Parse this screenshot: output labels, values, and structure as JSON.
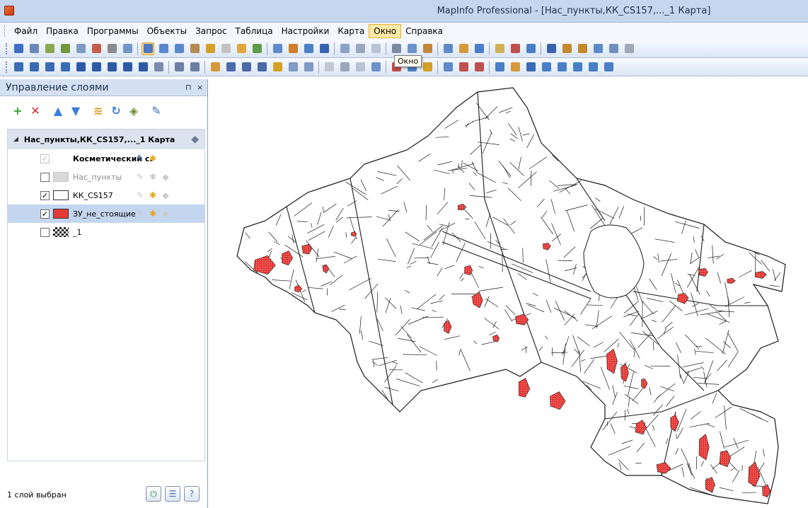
{
  "window": {
    "title": "MapInfo Professional - [Нас_пункты,КК_CS157,..._1 Карта]"
  },
  "menu": [
    {
      "label": "Файл",
      "active": false
    },
    {
      "label": "Правка",
      "active": false
    },
    {
      "label": "Программы",
      "active": false
    },
    {
      "label": "Объекты",
      "active": false
    },
    {
      "label": "Запрос",
      "active": false
    },
    {
      "label": "Таблица",
      "active": false
    },
    {
      "label": "Настройки",
      "active": false
    },
    {
      "label": "Карта",
      "active": false
    },
    {
      "label": "Окно",
      "active": true
    },
    {
      "label": "Справка",
      "active": false
    }
  ],
  "tooltip": {
    "text": "Окно"
  },
  "toolbar1": [
    "#3d6ec8",
    "#6a88b8",
    "#8aa94a",
    "#6f9a3a",
    "#7f9ac3",
    "#c45d4a",
    "#8b8b8b",
    "#7296c8",
    "#4c78c5",
    "#5a86cf",
    "#5a86cf",
    "#b48b52",
    "#d4a027",
    "#c2c2c2",
    "#e0a63a",
    "#5e9a4a",
    "#5d8ac9",
    "#d07d2c",
    "#4a7ec5",
    "#3a62b0",
    "#8aa2c8",
    "#9aa8bd",
    "#b8c3d3",
    "#7b8aa0",
    "#6d91c9",
    "#c2873a",
    "#5d8ac9",
    "#d6993a",
    "#4a7ec5",
    "#d1b05a",
    "#c05050",
    "#4a7ec5",
    "#3a62b0",
    "#c28a2c",
    "#c28a2c",
    "#5d8ac9",
    "#6e8fbf",
    "#a0a9b8"
  ],
  "toolbar2": [
    "#3b6bb3",
    "#3b6bb3",
    "#3b6bb3",
    "#3b6bb3",
    "#2d5aa5",
    "#2d5aa5",
    "#2d5aa5",
    "#2d5aa5",
    "#2d5aa5",
    "#7b8bb0",
    "#6d7fa6",
    "#6d7fa6",
    "#d6993a",
    "#4a6aa8",
    "#4a6aa8",
    "#4a6aa8",
    "#d4a027",
    "#7f9ac3",
    "#7f9ac3",
    "#c0c7d2",
    "#9aa8bd",
    "#b8c3d3",
    "#6d91c9",
    "#c24a4a",
    "#4a7ec5",
    "#d4a027",
    "#5d8ac9",
    "#c05050",
    "#c05050",
    "#4a7ec5",
    "#d6993a",
    "#3b6bb3",
    "#4a7ec5",
    "#4a7ec5",
    "#4a7ec5",
    "#4a7ec5",
    "#4a7ec5"
  ],
  "layer_panel": {
    "title": "Управление слоями",
    "pin": "⊓",
    "close": "×",
    "tools": [
      {
        "icon": "add-layer-icon",
        "glyph": "+",
        "color": "#3aa53a"
      },
      {
        "icon": "remove-layer-icon",
        "glyph": "✕",
        "color": "#d03030"
      },
      {
        "icon": "move-up-icon",
        "glyph": "▲",
        "color": "#3b7dd8"
      },
      {
        "icon": "move-down-icon",
        "glyph": "▼",
        "color": "#3b7dd8"
      },
      {
        "icon": "layer-properties-icon",
        "glyph": "≋",
        "color": "#d4a027"
      },
      {
        "icon": "refresh-icon",
        "glyph": "↻",
        "color": "#3b7dd8"
      },
      {
        "icon": "display-properties-icon",
        "glyph": "◈",
        "color": "#6a8d3a"
      },
      {
        "icon": "label-options-icon",
        "glyph": "✎",
        "color": "#3b6bb3"
      }
    ],
    "map_node": {
      "label": "Нас_пункты,КК_CS157,..._1 Карта",
      "expander": "◢"
    },
    "layers": [
      {
        "label": "Косметический с.",
        "checked": true,
        "disabled_check": true,
        "swatch": "none",
        "bold": true,
        "dim": false,
        "selected": false,
        "tools": [
          "edit",
          "select"
        ]
      },
      {
        "label": "Нас_пункты",
        "checked": false,
        "disabled_check": false,
        "swatch": "#d9d9d9",
        "bold": false,
        "dim": true,
        "selected": false,
        "tools": [
          "off",
          "off",
          "off"
        ]
      },
      {
        "label": "КК_CS157",
        "checked": true,
        "disabled_check": false,
        "swatch": "#ffffff",
        "bold": false,
        "dim": false,
        "selected": false,
        "tools": [
          "off",
          "star",
          "off"
        ]
      },
      {
        "label": "ЗУ_не_стоящие",
        "checked": true,
        "disabled_check": false,
        "swatch": "#e53935",
        "bold": false,
        "dim": false,
        "selected": true,
        "tools": [
          "off",
          "star",
          "off"
        ]
      },
      {
        "label": "_1",
        "checked": false,
        "disabled_check": false,
        "swatch": "checker",
        "bold": false,
        "dim": false,
        "selected": false,
        "tools": []
      }
    ],
    "status": "1 слой выбран",
    "status_buttons": [
      {
        "icon": "power-icon",
        "glyph": "⏻",
        "color": "#2f9a3a"
      },
      {
        "icon": "layer-list-icon",
        "glyph": "☰",
        "color": "#3b6bb3"
      },
      {
        "icon": "help-icon",
        "glyph": "?",
        "color": "#3b6bb3"
      }
    ]
  },
  "colors": {
    "parcel_fill": "#e53935",
    "outline": "#1a1a1a"
  }
}
